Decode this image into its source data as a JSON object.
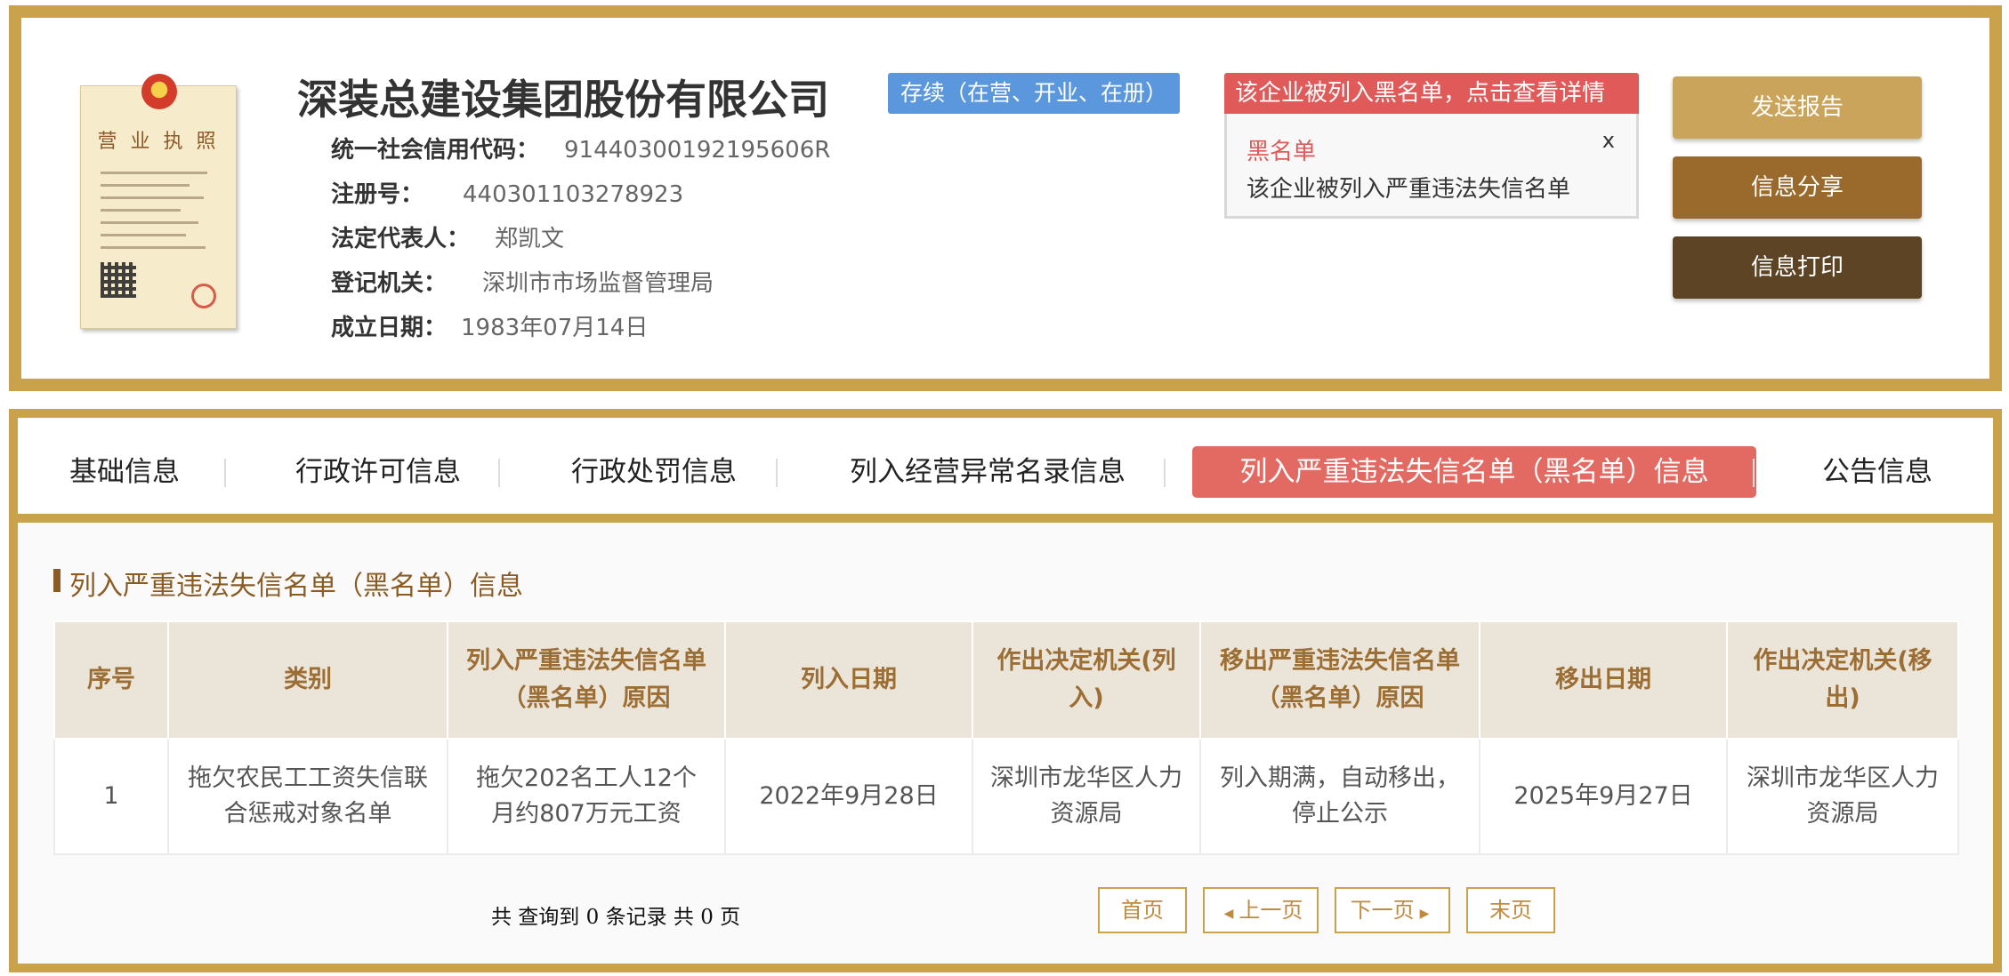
{
  "company": {
    "name": "深装总建设集团股份有限公司",
    "status": "存续（在营、开业、在册）",
    "license_image": {
      "title": "营 业 执 照"
    },
    "fields": [
      {
        "label": "统一社会信用代码：",
        "value": "91440300192195606R"
      },
      {
        "label": "注册号：",
        "value": "440301103278923"
      },
      {
        "label": "法定代表人：",
        "value": "郑凯文"
      },
      {
        "label": "登记机关：",
        "value": "深圳市市场监督管理局"
      },
      {
        "label": "成立日期：",
        "value": "1983年07月14日"
      }
    ]
  },
  "alert": {
    "header": "该企业被列入黑名单，点击查看详情",
    "title": "黑名单",
    "message": "该企业被列入严重违法失信名单",
    "close": "x"
  },
  "actions": {
    "send_report": "发送报告",
    "share": "信息分享",
    "print": "信息打印"
  },
  "tabs": [
    {
      "label": "基础信息"
    },
    {
      "label": "行政许可信息"
    },
    {
      "label": "行政处罚信息"
    },
    {
      "label": "列入经营异常名录信息"
    },
    {
      "label": "列入严重违法失信名单（黑名单）信息"
    },
    {
      "label": "公告信息"
    }
  ],
  "section": {
    "title": "列入严重违法失信名单（黑名单）信息"
  },
  "table": {
    "headers": [
      "序号",
      "类别",
      "列入严重违法失信名单（黑名单）原因",
      "列入日期",
      "作出决定机关(列入)",
      "移出严重违法失信名单（黑名单）原因",
      "移出日期",
      "作出决定机关(移出)"
    ],
    "rows": [
      [
        "1",
        "拖欠农民工工资失信联合惩戒对象名单",
        "拖欠202名工人12个月约807万元工资",
        "2022年9月28日",
        "深圳市龙华区人力资源局",
        "列入期满，自动移出，停止公示",
        "2025年9月27日",
        "深圳市龙华区人力资源局"
      ]
    ]
  },
  "pager": {
    "summary": "共 查询到 0 条记录 共 0 页",
    "first": "首页",
    "prev": "上一页",
    "next": "下一页",
    "last": "末页"
  },
  "colors": {
    "gold_border": "#c9a24b",
    "btn_send": "#c9a45a",
    "btn_share": "#9a6a2c",
    "btn_print": "#5c4424",
    "status_blue": "#5a97dc",
    "alert_red": "#e05a5a",
    "active_tab": "#e26a62"
  }
}
